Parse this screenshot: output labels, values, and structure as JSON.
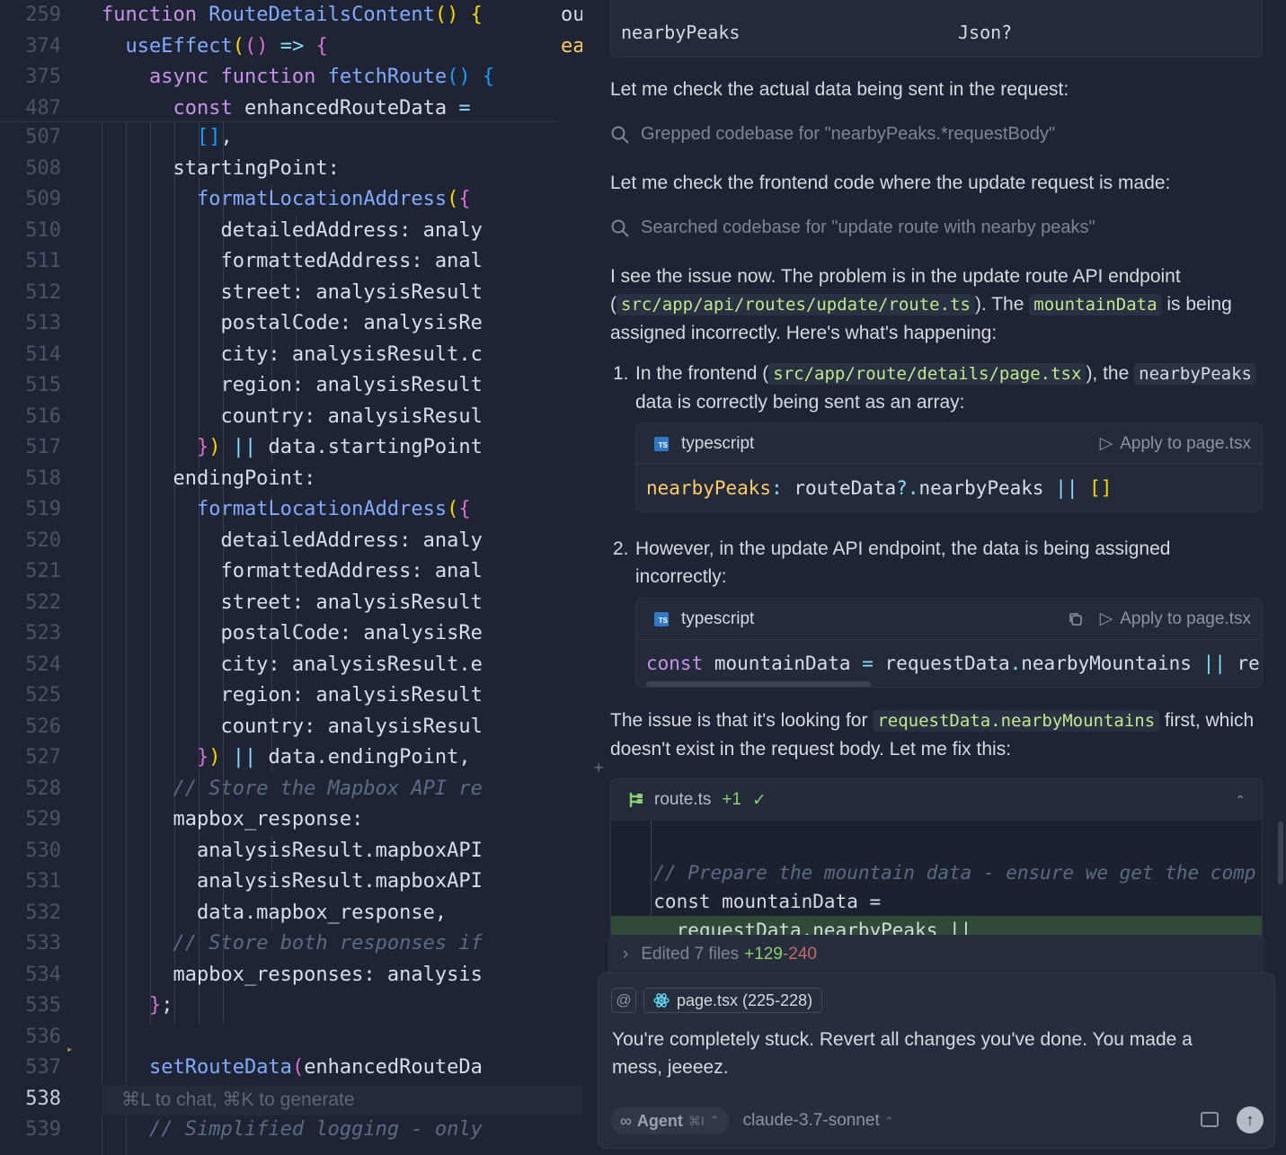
{
  "editor": {
    "sticky": [
      {
        "ln": "259",
        "tokens": [
          [
            "kw",
            "function "
          ],
          [
            "fn",
            "RouteDetailsContent"
          ],
          [
            "br",
            "()"
          ],
          [
            "var",
            " "
          ],
          [
            "br",
            "{"
          ]
        ]
      },
      {
        "ln": "374",
        "tokens": [
          [
            "var",
            "  "
          ],
          [
            "fn",
            "useEffect"
          ],
          [
            "br",
            "("
          ],
          [
            "br2",
            "()"
          ],
          [
            "op",
            " => "
          ],
          [
            "br2",
            "{"
          ]
        ]
      },
      {
        "ln": "375",
        "tokens": [
          [
            "var",
            "    "
          ],
          [
            "kw",
            "async function "
          ],
          [
            "fn",
            "fetchRoute"
          ],
          [
            "br3",
            "()"
          ],
          [
            "var",
            " "
          ],
          [
            "br3",
            "{"
          ]
        ]
      },
      {
        "ln": "487",
        "tokens": [
          [
            "var",
            "      "
          ],
          [
            "kw",
            "const "
          ],
          [
            "var",
            "enhancedRouteData "
          ],
          [
            "op",
            "="
          ]
        ]
      }
    ],
    "lines": [
      {
        "ln": "507",
        "tokens": [
          [
            "var",
            "        "
          ],
          [
            "br3",
            "[]"
          ],
          [
            "var",
            ","
          ]
        ]
      },
      {
        "ln": "508",
        "tokens": [
          [
            "var",
            "      startingPoint:"
          ]
        ]
      },
      {
        "ln": "509",
        "tokens": [
          [
            "var",
            "        "
          ],
          [
            "fn",
            "formatLocationAddress"
          ],
          [
            "br",
            "("
          ],
          [
            "br2",
            "{"
          ]
        ]
      },
      {
        "ln": "510",
        "tokens": [
          [
            "var",
            "          detailedAddress: analy"
          ]
        ]
      },
      {
        "ln": "511",
        "tokens": [
          [
            "var",
            "          formattedAddress: anal"
          ]
        ]
      },
      {
        "ln": "512",
        "tokens": [
          [
            "var",
            "          street: analysisResult"
          ]
        ]
      },
      {
        "ln": "513",
        "tokens": [
          [
            "var",
            "          postalCode: analysisRe"
          ]
        ]
      },
      {
        "ln": "514",
        "tokens": [
          [
            "var",
            "          city: analysisResult.c"
          ]
        ]
      },
      {
        "ln": "515",
        "tokens": [
          [
            "var",
            "          region: analysisResult"
          ]
        ]
      },
      {
        "ln": "516",
        "tokens": [
          [
            "var",
            "          country: analysisResul"
          ]
        ]
      },
      {
        "ln": "517",
        "tokens": [
          [
            "var",
            "        "
          ],
          [
            "br2",
            "}"
          ],
          [
            "br",
            ") "
          ],
          [
            "op",
            "||"
          ],
          [
            "var",
            " data.startingPoint"
          ]
        ]
      },
      {
        "ln": "518",
        "tokens": [
          [
            "var",
            "      endingPoint:"
          ]
        ]
      },
      {
        "ln": "519",
        "tokens": [
          [
            "var",
            "        "
          ],
          [
            "fn",
            "formatLocationAddress"
          ],
          [
            "br",
            "("
          ],
          [
            "br2",
            "{"
          ]
        ]
      },
      {
        "ln": "520",
        "tokens": [
          [
            "var",
            "          detailedAddress: analy"
          ]
        ]
      },
      {
        "ln": "521",
        "tokens": [
          [
            "var",
            "          formattedAddress: anal"
          ]
        ]
      },
      {
        "ln": "522",
        "tokens": [
          [
            "var",
            "          street: analysisResult"
          ]
        ]
      },
      {
        "ln": "523",
        "tokens": [
          [
            "var",
            "          postalCode: analysisRe"
          ]
        ]
      },
      {
        "ln": "524",
        "tokens": [
          [
            "var",
            "          city: analysisResult.e"
          ]
        ]
      },
      {
        "ln": "525",
        "tokens": [
          [
            "var",
            "          region: analysisResult"
          ]
        ]
      },
      {
        "ln": "526",
        "tokens": [
          [
            "var",
            "          country: analysisResul"
          ]
        ]
      },
      {
        "ln": "527",
        "tokens": [
          [
            "var",
            "        "
          ],
          [
            "br2",
            "}"
          ],
          [
            "br",
            ") "
          ],
          [
            "op",
            "||"
          ],
          [
            "var",
            " data.endingPoint,"
          ]
        ]
      },
      {
        "ln": "528",
        "tokens": [
          [
            "var",
            "      "
          ],
          [
            "cm",
            "// Store the Mapbox API re"
          ]
        ]
      },
      {
        "ln": "529",
        "tokens": [
          [
            "var",
            "      mapbox_response:"
          ]
        ]
      },
      {
        "ln": "530",
        "tokens": [
          [
            "var",
            "        analysisResult.mapboxAPI"
          ]
        ]
      },
      {
        "ln": "531",
        "tokens": [
          [
            "var",
            "        analysisResult.mapboxAPI"
          ]
        ]
      },
      {
        "ln": "532",
        "tokens": [
          [
            "var",
            "        data.mapbox_response,"
          ]
        ]
      },
      {
        "ln": "533",
        "tokens": [
          [
            "var",
            "      "
          ],
          [
            "cm",
            "// Store both responses if"
          ]
        ]
      },
      {
        "ln": "534",
        "tokens": [
          [
            "var",
            "      mapbox_responses: analysis"
          ]
        ]
      },
      {
        "ln": "535",
        "tokens": [
          [
            "var",
            "    "
          ],
          [
            "br2",
            "}"
          ],
          [
            "var",
            ";"
          ]
        ]
      },
      {
        "ln": "536",
        "tokens": [
          [
            "var",
            ""
          ]
        ]
      },
      {
        "ln": "537",
        "tokens": [
          [
            "var",
            "    "
          ],
          [
            "fn",
            "setRouteData"
          ],
          [
            "br2",
            "("
          ],
          [
            "var",
            "enhancedRouteDa"
          ]
        ]
      },
      {
        "ln": "538",
        "tokens": [
          [
            "var",
            ""
          ]
        ]
      },
      {
        "ln": "539",
        "tokens": [
          [
            "var",
            "    "
          ],
          [
            "cm",
            "// Simplified logging - only"
          ]
        ]
      }
    ],
    "hint": "⌘L to chat, ⌘K to generate",
    "peek_lines": [
      "ou",
      "ea"
    ]
  },
  "chat": {
    "table_row": {
      "name": "nearbyPeaks",
      "type": "Json?"
    },
    "p1": "Let me check the actual data being sent in the request:",
    "tool1": "Grepped codebase for \"nearbyPeaks.*requestBody\"",
    "p2": "Let me check the frontend code where the update request is made:",
    "tool2": "Searched codebase for \"update route with nearby peaks\"",
    "p3_a": "I see the issue now. The problem is in the update route API endpoint (",
    "p3_code1": "src/app/api/routes/update/route.ts",
    "p3_b": "). The ",
    "p3_code2": "mountainData",
    "p3_c": " is being assigned incorrectly. Here's what's happening:",
    "li1_num": "1.",
    "li1_a": "In the frontend (",
    "li1_code1": "src/app/route/details/page.tsx",
    "li1_b": "), the ",
    "li1_code2": "nearbyPeaks",
    "li1_c": " data is correctly being sent as an array:",
    "code1": {
      "lang": "typescript",
      "apply": "Apply to page.tsx",
      "ts_badge": "TS"
    },
    "code1_tokens": [
      [
        "prop",
        "nearbyPeaks"
      ],
      [
        "op",
        ": "
      ],
      [
        "var",
        "routeData"
      ],
      [
        "op",
        "?."
      ],
      [
        "var",
        "nearbyPeaks "
      ],
      [
        "op",
        "||"
      ],
      [
        "var",
        " "
      ],
      [
        "br",
        "[]"
      ]
    ],
    "li2_num": "2.",
    "li2": "However, in the update API endpoint, the data is being assigned incorrectly:",
    "code2": {
      "lang": "typescript",
      "apply": "Apply to page.tsx",
      "ts_badge": "TS"
    },
    "code2_tokens": [
      [
        "kw",
        "const "
      ],
      [
        "var",
        "mountainData "
      ],
      [
        "op",
        "="
      ],
      [
        "var",
        " requestData"
      ],
      [
        "op",
        "."
      ],
      [
        "var",
        "nearbyMountains "
      ],
      [
        "op",
        "||"
      ],
      [
        "var",
        " re"
      ]
    ],
    "p4_a": "The issue is that it's looking for ",
    "p4_code": "requestData.nearbyMountains",
    "p4_b": " first, which doesn't exist in the request body. Let me fix this:",
    "diff": {
      "file": "route.ts",
      "added": "+1",
      "lines": [
        {
          "text": "",
          "kind": "ctx"
        },
        {
          "text": "  // Prepare the mountain data - ensure we get the comp",
          "kind": "cm"
        },
        {
          "text": "  const mountainData =",
          "kind": "code"
        },
        {
          "text": "    requestData.nearbyPeaks ||",
          "kind": "add"
        }
      ]
    },
    "edited": {
      "label": "Edited 7 files",
      "plus": "+129",
      "minus": "-240"
    },
    "composer": {
      "at": "@",
      "context_chip": "page.tsx (225-228)",
      "text": "You're completely stuck. Revert all changes you've done. You made a mess, jeeeez.",
      "agent": "Agent",
      "agent_shortcut": "⌘I",
      "model": "claude-3.7-sonnet"
    }
  },
  "colors": {
    "accent_green": "#8ccf6e",
    "accent_red": "#c26b6b",
    "editor_bg": "#1e2433"
  }
}
